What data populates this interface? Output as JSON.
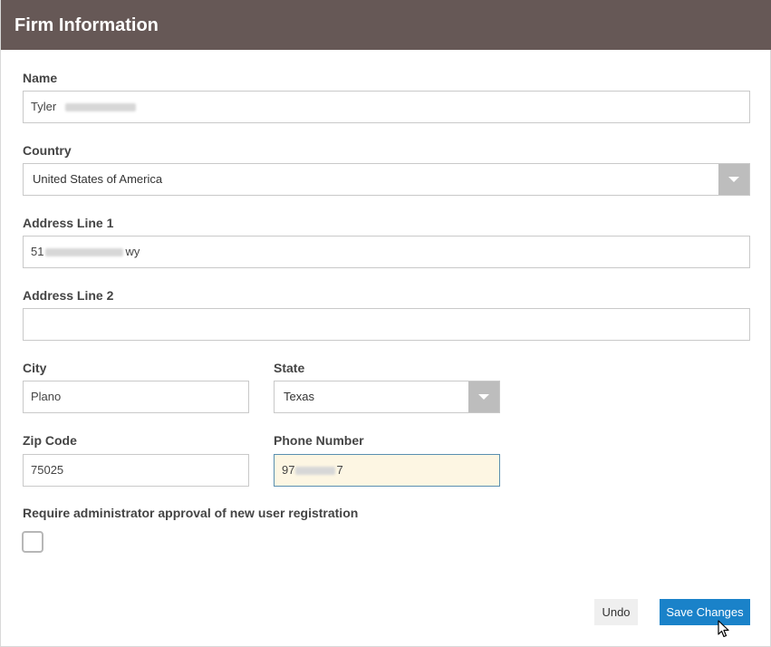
{
  "header": {
    "title": "Firm Information"
  },
  "form": {
    "name": {
      "label": "Name",
      "value_visible": "Tyler"
    },
    "country": {
      "label": "Country",
      "value": "United States of America"
    },
    "address1": {
      "label": "Address Line 1",
      "value_prefix": "51",
      "value_suffix": "wy"
    },
    "address2": {
      "label": "Address Line 2",
      "value": ""
    },
    "city": {
      "label": "City",
      "value": "Plano"
    },
    "state": {
      "label": "State",
      "value": "Texas"
    },
    "zip": {
      "label": "Zip Code",
      "value": "75025"
    },
    "phone": {
      "label": "Phone Number",
      "value_prefix": "97",
      "value_suffix": "7"
    },
    "approval": {
      "label": "Require administrator approval of new user registration",
      "checked": false
    }
  },
  "actions": {
    "undo_label": "Undo",
    "save_label": "Save Changes"
  },
  "colors": {
    "header_bg": "#665856",
    "primary_button": "#1a82c9",
    "focused_field_bg": "#fdf6e3"
  }
}
